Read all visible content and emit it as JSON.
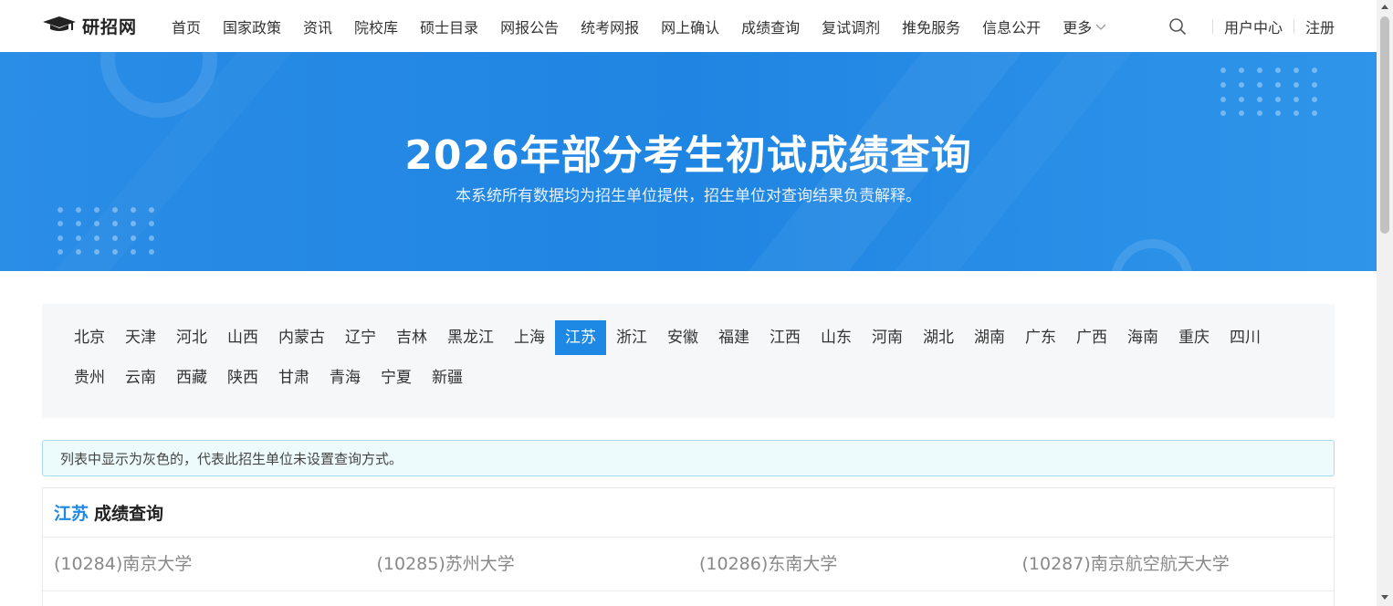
{
  "header": {
    "logo_text": "研招网",
    "nav": [
      "首页",
      "国家政策",
      "资讯",
      "院校库",
      "硕士目录",
      "网报公告",
      "统考网报",
      "网上确认",
      "成绩查询",
      "复试调剂",
      "推免服务",
      "信息公开"
    ],
    "more_label": "更多",
    "user_center": "用户中心",
    "register": "注册"
  },
  "banner": {
    "title": "2026年部分考生初试成绩查询",
    "subtitle": "本系统所有数据均为招生单位提供，招生单位对查询结果负责解释。"
  },
  "provinces": {
    "row1": [
      "北京",
      "天津",
      "河北",
      "山西",
      "内蒙古",
      "辽宁",
      "吉林",
      "黑龙江",
      "上海",
      "江苏",
      "浙江",
      "安徽",
      "福建",
      "江西",
      "山东",
      "河南",
      "湖北",
      "湖南",
      "广东",
      "广西",
      "海南",
      "重庆",
      "四川"
    ],
    "row2": [
      "贵州",
      "云南",
      "西藏",
      "陕西",
      "甘肃",
      "青海",
      "宁夏",
      "新疆"
    ],
    "selected": "江苏"
  },
  "notice": "列表中显示为灰色的，代表此招生单位未设置查询方式。",
  "results": {
    "province": "江苏",
    "title": "成绩查询",
    "universities": [
      "(10284)南京大学",
      "(10285)苏州大学",
      "(10286)东南大学",
      "(10287)南京航空航天大学"
    ]
  },
  "colors": {
    "accent": "#1e88e5",
    "banner": "#2a8de6",
    "disabled_text": "#888888"
  }
}
